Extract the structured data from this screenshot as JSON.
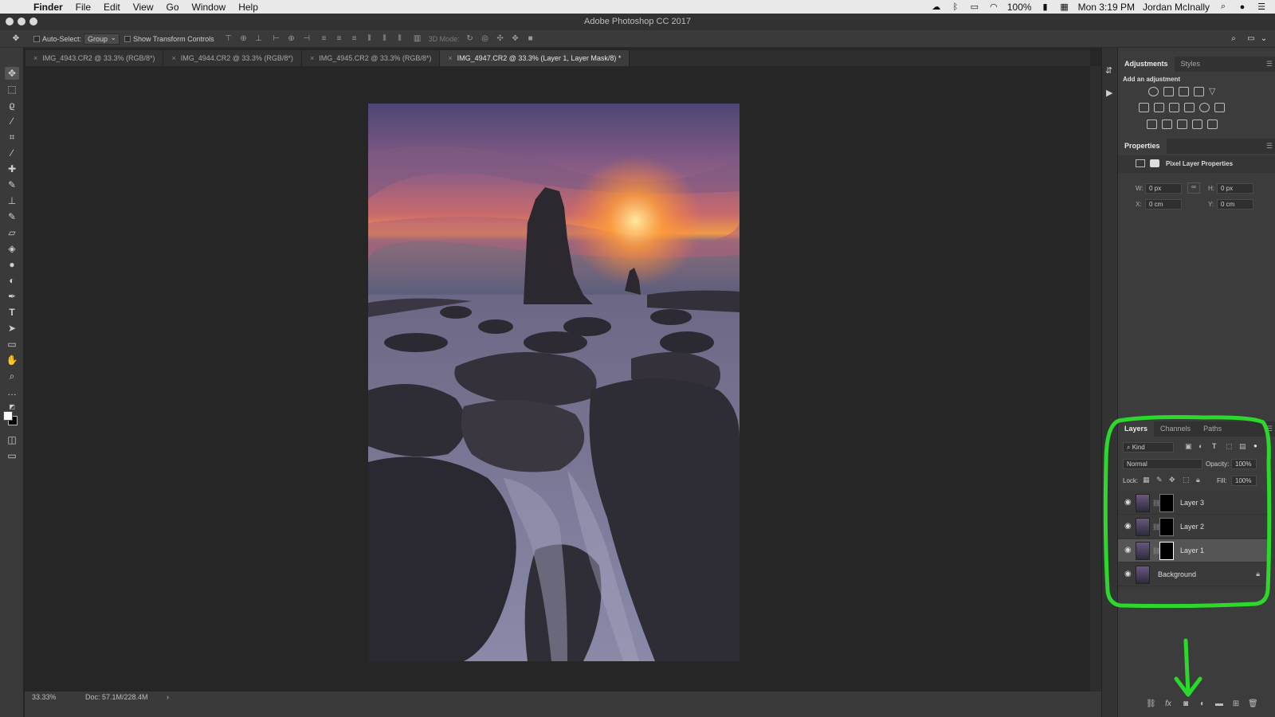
{
  "menubar": {
    "app": "Finder",
    "items": [
      "File",
      "Edit",
      "View",
      "Go",
      "Window",
      "Help"
    ],
    "battery": "100%",
    "clock": "Mon 3:19 PM",
    "user": "Jordan McInally"
  },
  "window": {
    "title": "Adobe Photoshop CC 2017"
  },
  "options": {
    "auto_select_label": "Auto-Select:",
    "auto_select_value": "Group",
    "transform_label": "Show Transform Controls",
    "mode3d_label": "3D Mode:"
  },
  "tabs": [
    {
      "label": "IMG_4943.CR2 @ 33.3% (RGB/8*)"
    },
    {
      "label": "IMG_4944.CR2 @ 33.3% (RGB/8*)"
    },
    {
      "label": "IMG_4945.CR2 @ 33.3% (RGB/8*)"
    },
    {
      "label": "IMG_4947.CR2 @ 33.3% (Layer 1, Layer Mask/8) *"
    }
  ],
  "status": {
    "zoom": "33.33%",
    "doc": "Doc: 57.1M/228.4M"
  },
  "adjustments": {
    "tab_adjustments": "Adjustments",
    "tab_styles": "Styles",
    "heading": "Add an adjustment"
  },
  "properties": {
    "title": "Properties",
    "kind": "Pixel Layer Properties",
    "w_label": "W:",
    "w_value": "0 px",
    "h_label": "H:",
    "h_value": "0 px",
    "x_label": "X:",
    "x_value": "0 cm",
    "y_label": "Y:",
    "y_value": "0 cm"
  },
  "layers_panel": {
    "tab_layers": "Layers",
    "tab_channels": "Channels",
    "tab_paths": "Paths",
    "filter_kind": "Kind",
    "blend_mode": "Normal",
    "opacity_label": "Opacity:",
    "opacity_value": "100%",
    "lock_label": "Lock:",
    "fill_label": "Fill:",
    "fill_value": "100%",
    "layers": [
      {
        "name": "Layer 3"
      },
      {
        "name": "Layer 2"
      },
      {
        "name": "Layer 1"
      },
      {
        "name": "Background"
      }
    ]
  },
  "colors": {
    "annotation": "#2bd82b",
    "panel": "#3c3c3c",
    "canvas": "#262626"
  }
}
